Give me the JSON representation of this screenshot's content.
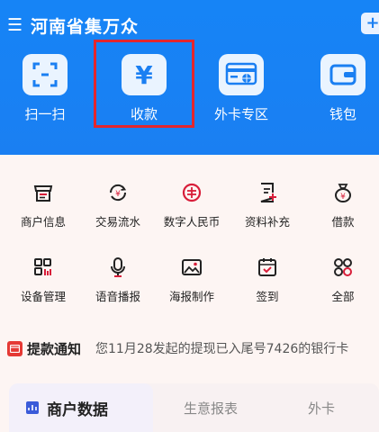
{
  "header": {
    "title": "河南省集万众",
    "menu_icon": "menu-icon",
    "add_icon": "plus-icon",
    "background": "#1a7ff2"
  },
  "quick_actions": [
    {
      "label": "扫一扫",
      "icon": "scan-icon"
    },
    {
      "label": "收款",
      "icon": "yuan-icon",
      "highlighted": true
    },
    {
      "label": "外卡专区",
      "icon": "card-globe-icon"
    },
    {
      "label": "钱包",
      "icon": "wallet-icon"
    }
  ],
  "grid": [
    {
      "label": "商户信息",
      "icon": "shop-info-icon"
    },
    {
      "label": "交易流水",
      "icon": "transaction-icon"
    },
    {
      "label": "数字人民币",
      "icon": "digital-rmb-icon"
    },
    {
      "label": "资料补充",
      "icon": "doc-add-icon"
    },
    {
      "label": "借款",
      "icon": "loan-bag-icon"
    },
    {
      "label": "设备管理",
      "icon": "device-icon"
    },
    {
      "label": "语音播报",
      "icon": "microphone-icon"
    },
    {
      "label": "海报制作",
      "icon": "image-icon"
    },
    {
      "label": "签到",
      "icon": "calendar-check-icon"
    },
    {
      "label": "全部",
      "icon": "grid-all-icon"
    }
  ],
  "notice": {
    "title": "提款通知",
    "text": "您11月28发起的提现已入尾号7426的银行卡"
  },
  "data_tabs": {
    "active": "商户数据",
    "tabs": [
      "生意报表",
      "外卡"
    ]
  },
  "colors": {
    "accent": "#1a7ff2",
    "highlight_border": "#e3262d",
    "red": "#d81e3a"
  }
}
